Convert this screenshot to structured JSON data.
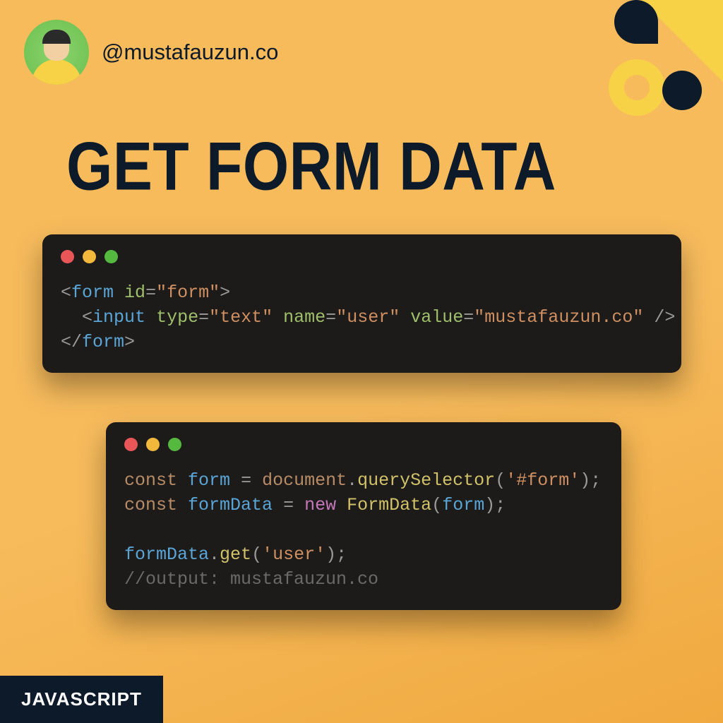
{
  "header": {
    "handle": "@mustafauzun.co"
  },
  "title": "GET FORM DATA",
  "code": {
    "html": {
      "form_tag": "form",
      "form_attr": "id",
      "form_attr_val": "form",
      "input_tag": "input",
      "input_type_attr": "type",
      "input_type_val": "text",
      "input_name_attr": "name",
      "input_name_val": "user",
      "input_value_attr": "value",
      "input_value_val": "mustafauzun.co"
    },
    "js": {
      "const1": "const",
      "var_form": "form",
      "eq": "=",
      "document": "document",
      "querySelector": "querySelector",
      "selector_arg": "'#form'",
      "const2": "const",
      "var_formData": "formData",
      "new": "new",
      "FormData": "FormData",
      "form_arg": "form",
      "get": "get",
      "get_arg": "'user'",
      "comment": "//output: mustafauzun.co"
    }
  },
  "footer": {
    "tag": "JAVASCRIPT"
  }
}
